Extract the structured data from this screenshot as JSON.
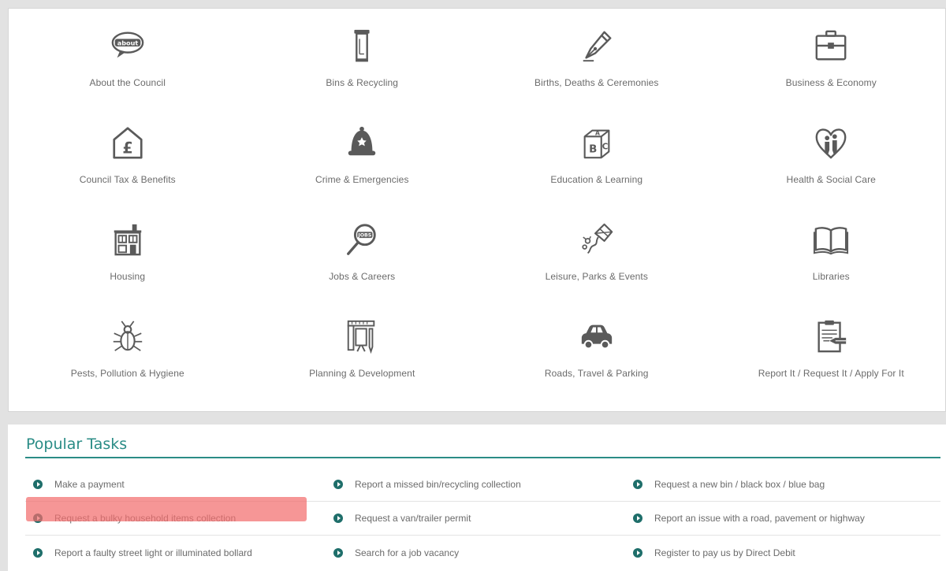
{
  "services": [
    {
      "label": "About the Council",
      "icon": "about-speech-bubble-icon"
    },
    {
      "label": "Bins & Recycling",
      "icon": "wheelie-bin-icon"
    },
    {
      "label": "Births, Deaths & Ceremonies",
      "icon": "fountain-pen-icon"
    },
    {
      "label": "Business & Economy",
      "icon": "briefcase-icon"
    },
    {
      "label": "Council Tax & Benefits",
      "icon": "pound-house-icon"
    },
    {
      "label": "Crime & Emergencies",
      "icon": "police-helmet-icon"
    },
    {
      "label": "Education & Learning",
      "icon": "abc-blocks-icon"
    },
    {
      "label": "Health & Social Care",
      "icon": "heart-people-icon"
    },
    {
      "label": "Housing",
      "icon": "house-icon"
    },
    {
      "label": "Jobs & Careers",
      "icon": "magnifier-jobs-icon"
    },
    {
      "label": "Leisure, Parks & Events",
      "icon": "kite-icon"
    },
    {
      "label": "Libraries",
      "icon": "open-book-icon"
    },
    {
      "label": "Pests, Pollution & Hygiene",
      "icon": "bug-icon"
    },
    {
      "label": "Planning & Development",
      "icon": "planning-tools-icon"
    },
    {
      "label": "Roads, Travel & Parking",
      "icon": "car-icon"
    },
    {
      "label": "Report It / Request It / Apply For It",
      "icon": "clipboard-icon"
    }
  ],
  "popular_tasks": {
    "title": "Popular Tasks",
    "rows": [
      [
        "Make a payment",
        "Report a missed bin/recycling collection",
        "Request a new bin / black box / blue bag"
      ],
      [
        "Request a bulky household items collection",
        "Request a van/trailer permit",
        "Report an issue with a road, pavement or highway"
      ],
      [
        "Report a faulty street light or illuminated bollard",
        "Search for a job vacancy",
        "Register to pay us by Direct Debit"
      ]
    ]
  },
  "colors": {
    "accent": "#2a8c86",
    "bullet": "#1e6e6a",
    "icon": "#5a5a5a",
    "text": "#6b6b6b",
    "highlight": "#f26e6e"
  }
}
